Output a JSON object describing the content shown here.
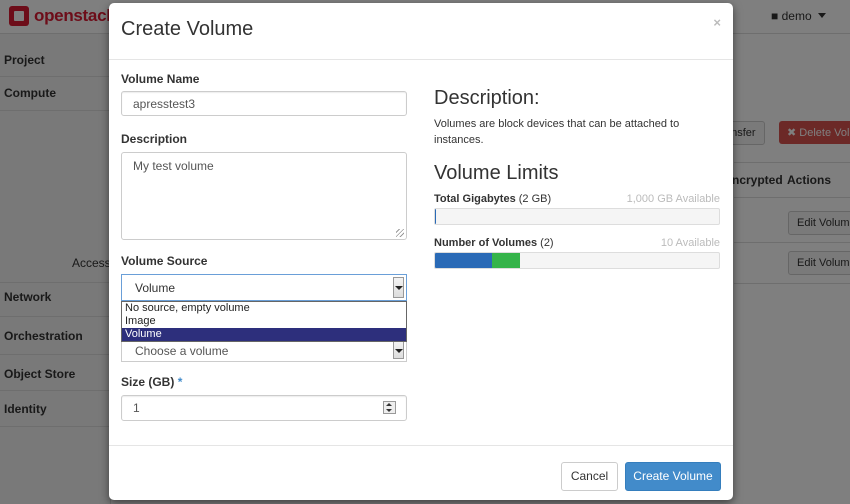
{
  "brand": {
    "name": "openstack"
  },
  "user_menu": {
    "label": "demo"
  },
  "sidebar": {
    "items": [
      {
        "label": "Project"
      },
      {
        "label": "Compute"
      },
      {
        "label": "Access"
      },
      {
        "label": "Network"
      },
      {
        "label": "Orchestration"
      },
      {
        "label": "Object Store"
      },
      {
        "label": "Identity"
      }
    ]
  },
  "background_table": {
    "transfer_button": "ansfer",
    "delete_button": "Delete Volu",
    "headers": {
      "encrypted": "ncrypted",
      "actions": "Actions"
    },
    "row_actions": [
      "Edit Volume",
      "Edit Volume"
    ]
  },
  "modal": {
    "title": "Create Volume",
    "close": "×",
    "form": {
      "volume_name": {
        "label": "Volume Name",
        "value": "apresstest3"
      },
      "description": {
        "label": "Description",
        "value": "My test volume"
      },
      "volume_source": {
        "label": "Volume Source",
        "selected": "Volume",
        "options": [
          "No source, empty volume",
          "Image",
          "Volume"
        ]
      },
      "use_volume": {
        "placeholder": "Choose a volume"
      },
      "size": {
        "label": "Size (GB)",
        "required_mark": "*",
        "value": "1"
      }
    },
    "info": {
      "description_heading": "Description:",
      "description_text": "Volumes are block devices that can be attached to instances.",
      "limits_heading": "Volume Limits",
      "quotas": [
        {
          "label": "Total Gigabytes",
          "usage": "(2 GB)",
          "available": "1,000 GB Available",
          "used_fraction": 0.002,
          "added_fraction": 0.0
        },
        {
          "label": "Number of Volumes",
          "usage": "(2)",
          "available": "10 Available",
          "used_fraction": 0.2,
          "added_fraction": 0.1
        }
      ]
    },
    "footer": {
      "cancel": "Cancel",
      "submit": "Create Volume"
    }
  },
  "colors": {
    "brand": "#da1a32",
    "primary": "#428bca",
    "bar_used": "#2a6ab6",
    "bar_added": "#35b44a",
    "selected_option": "#2d2f7c",
    "danger": "#d9534f"
  }
}
